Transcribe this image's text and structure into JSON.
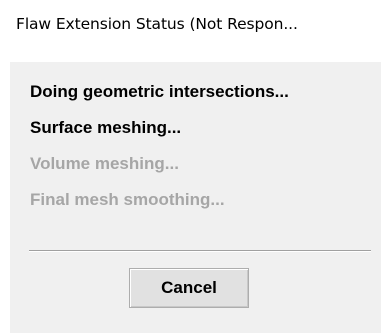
{
  "window": {
    "title": "Flaw Extension Status (Not Respon..."
  },
  "steps": [
    {
      "label": "Doing geometric intersections...",
      "state": "active"
    },
    {
      "label": "Surface meshing...",
      "state": "active"
    },
    {
      "label": "Volume meshing...",
      "state": "inactive"
    },
    {
      "label": "Final mesh smoothing...",
      "state": "inactive"
    }
  ],
  "buttons": {
    "cancel_label": "Cancel"
  },
  "colors": {
    "active_text": "#000000",
    "inactive_text": "#a6a6a6",
    "panel_background": "#f0f0f0"
  }
}
